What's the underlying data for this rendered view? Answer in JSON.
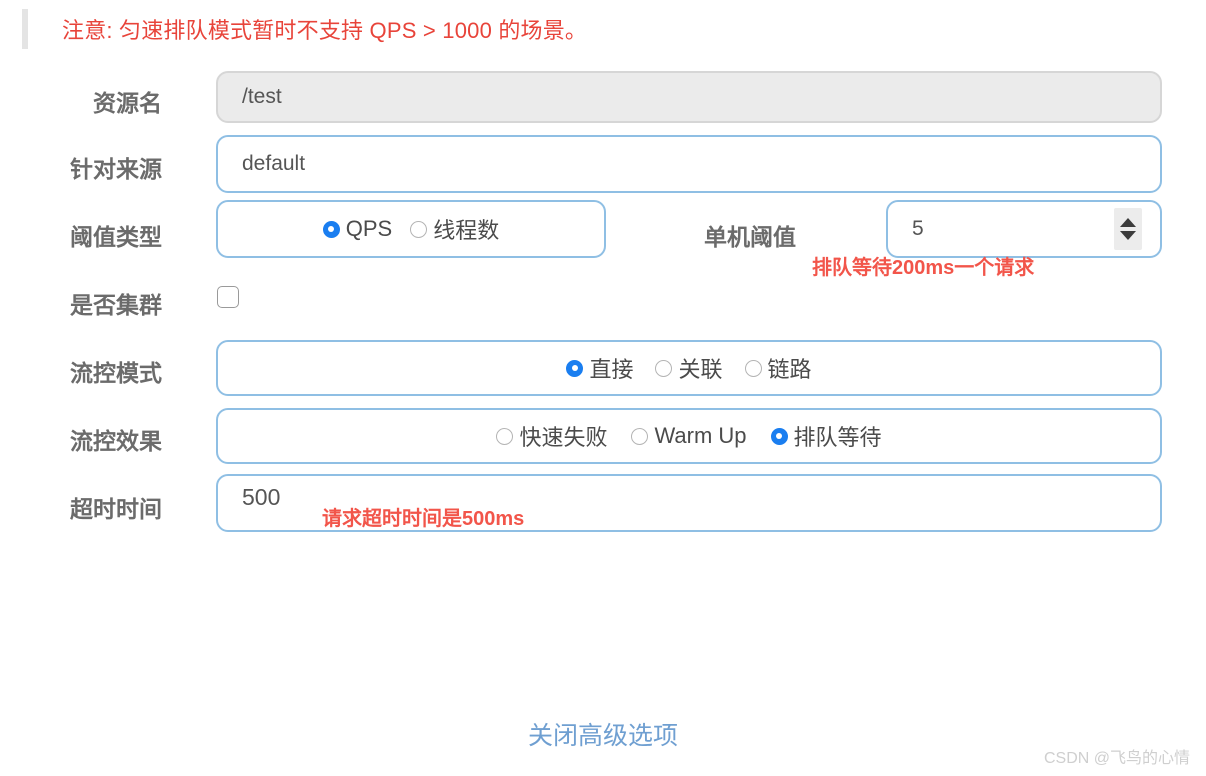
{
  "notice": {
    "text": "注意: 匀速排队模式暂时不支持 QPS > 1000 的场景。",
    "color": "#e8443a"
  },
  "form": {
    "rows": [
      {
        "label": "资源名",
        "type": "text-disabled",
        "value": "/test"
      },
      {
        "label": "针对来源",
        "type": "text",
        "value": "default"
      },
      {
        "label": "阈值类型",
        "type": "radio-group",
        "options": [
          {
            "label": "QPS",
            "selected": true
          },
          {
            "label": "线程数",
            "selected": false
          }
        ],
        "secondary_label": "单机阈值",
        "secondary_value": "5"
      },
      {
        "label": "是否集群",
        "type": "checkbox",
        "checked": false
      },
      {
        "label": "流控模式",
        "type": "radio-group",
        "options": [
          {
            "label": "直接",
            "selected": true
          },
          {
            "label": "关联",
            "selected": false
          },
          {
            "label": "链路",
            "selected": false
          }
        ]
      },
      {
        "label": "流控效果",
        "type": "radio-group",
        "options": [
          {
            "label": "快速失败",
            "selected": false
          },
          {
            "label": "Warm Up",
            "selected": false
          },
          {
            "label": "排队等待",
            "selected": true
          }
        ]
      },
      {
        "label": "超时时间",
        "type": "text",
        "value": "500"
      }
    ]
  },
  "annotations": [
    {
      "text": "排队等待200ms一个请求",
      "color": "#f2554a"
    },
    {
      "text": "请求超时时间是500ms",
      "color": "#f2554a"
    }
  ],
  "footer": {
    "advanced_link": "关闭高级选项",
    "watermark": "CSDN @飞鸟的心情"
  },
  "icons": {
    "spinner_up": "triangle-up-icon",
    "spinner_down": "triangle-down-icon"
  }
}
